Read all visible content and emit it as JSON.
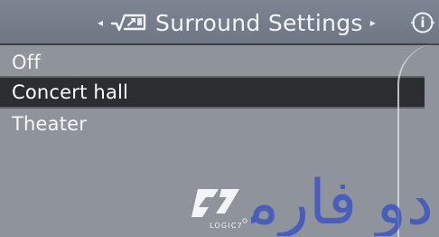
{
  "header": {
    "left_arrow": "◂",
    "title": "Surround Settings",
    "right_arrow": "▸",
    "info": "i"
  },
  "menu": {
    "items": [
      {
        "label": "Off",
        "selected": false
      },
      {
        "label": "Concert hall",
        "selected": true
      },
      {
        "label": "Theater",
        "selected": false
      }
    ]
  },
  "logo": {
    "text": "LOGIC7"
  },
  "colors": {
    "background": "#8f949c",
    "header": "#747c89",
    "selected_row": "#2b2d31",
    "text": "#f7f7f8",
    "watermark": "#2f49c6"
  },
  "icons": {
    "surround": "surround-sound-icon",
    "info": "info-icon",
    "brand": "logic7-logo"
  },
  "watermark": {
    "text": "دو فارما"
  }
}
